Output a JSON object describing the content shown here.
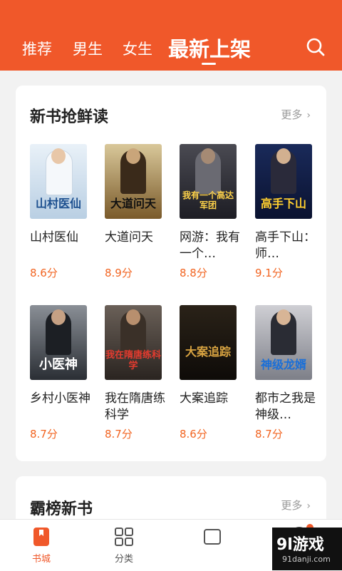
{
  "header": {
    "tabs": [
      "推荐",
      "男生",
      "女生"
    ],
    "active_tab": "最新上架",
    "accent": "#f0582a",
    "search_icon": "search-icon"
  },
  "sections": [
    {
      "title": "新书抢鲜读",
      "more": "更多",
      "books": [
        {
          "title": "山村医仙",
          "score": "8.6分",
          "cover_text": "山村医仙"
        },
        {
          "title": "大道问天",
          "score": "8.9分",
          "cover_text": "大道问天"
        },
        {
          "title": "网游：我有一个…",
          "score": "8.8分",
          "cover_text": "我有一个高达军团"
        },
        {
          "title": "高手下山：师…",
          "score": "9.1分",
          "cover_text": "高手下山"
        },
        {
          "title": "乡村小医神",
          "score": "8.7分",
          "cover_text": "小医神"
        },
        {
          "title": "我在隋唐练科学",
          "score": "8.7分",
          "cover_text": "我在隋唐练科学"
        },
        {
          "title": "大案追踪",
          "score": "8.6分",
          "cover_text": "大案追踪"
        },
        {
          "title": "都市之我是神级…",
          "score": "8.7分",
          "cover_text": "神级龙婿"
        }
      ]
    },
    {
      "title": "霸榜新书",
      "more": "更多"
    }
  ],
  "tabbar": [
    {
      "label": "书城",
      "icon": "bookstore-icon",
      "active": true
    },
    {
      "label": "分类",
      "icon": "category-grid-icon",
      "active": false
    },
    {
      "label": "",
      "icon": "shelf-icon",
      "active": false
    },
    {
      "label": "",
      "icon": "profile-icon",
      "active": false
    }
  ],
  "watermark": {
    "main": "9l游戏",
    "sub": "91danji.com"
  }
}
